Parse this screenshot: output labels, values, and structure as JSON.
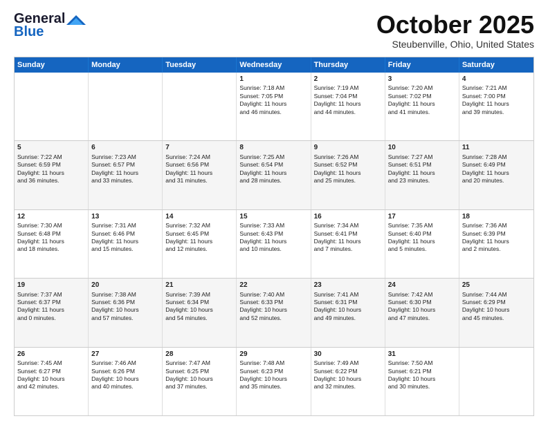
{
  "header": {
    "logo_general": "General",
    "logo_blue": "Blue",
    "month_title": "October 2025",
    "location": "Steubenville, Ohio, United States"
  },
  "days_of_week": [
    "Sunday",
    "Monday",
    "Tuesday",
    "Wednesday",
    "Thursday",
    "Friday",
    "Saturday"
  ],
  "rows": [
    {
      "alt": false,
      "cells": [
        {
          "day": "",
          "text": ""
        },
        {
          "day": "",
          "text": ""
        },
        {
          "day": "",
          "text": ""
        },
        {
          "day": "1",
          "text": "Sunrise: 7:18 AM\nSunset: 7:05 PM\nDaylight: 11 hours\nand 46 minutes."
        },
        {
          "day": "2",
          "text": "Sunrise: 7:19 AM\nSunset: 7:04 PM\nDaylight: 11 hours\nand 44 minutes."
        },
        {
          "day": "3",
          "text": "Sunrise: 7:20 AM\nSunset: 7:02 PM\nDaylight: 11 hours\nand 41 minutes."
        },
        {
          "day": "4",
          "text": "Sunrise: 7:21 AM\nSunset: 7:00 PM\nDaylight: 11 hours\nand 39 minutes."
        }
      ]
    },
    {
      "alt": true,
      "cells": [
        {
          "day": "5",
          "text": "Sunrise: 7:22 AM\nSunset: 6:59 PM\nDaylight: 11 hours\nand 36 minutes."
        },
        {
          "day": "6",
          "text": "Sunrise: 7:23 AM\nSunset: 6:57 PM\nDaylight: 11 hours\nand 33 minutes."
        },
        {
          "day": "7",
          "text": "Sunrise: 7:24 AM\nSunset: 6:56 PM\nDaylight: 11 hours\nand 31 minutes."
        },
        {
          "day": "8",
          "text": "Sunrise: 7:25 AM\nSunset: 6:54 PM\nDaylight: 11 hours\nand 28 minutes."
        },
        {
          "day": "9",
          "text": "Sunrise: 7:26 AM\nSunset: 6:52 PM\nDaylight: 11 hours\nand 25 minutes."
        },
        {
          "day": "10",
          "text": "Sunrise: 7:27 AM\nSunset: 6:51 PM\nDaylight: 11 hours\nand 23 minutes."
        },
        {
          "day": "11",
          "text": "Sunrise: 7:28 AM\nSunset: 6:49 PM\nDaylight: 11 hours\nand 20 minutes."
        }
      ]
    },
    {
      "alt": false,
      "cells": [
        {
          "day": "12",
          "text": "Sunrise: 7:30 AM\nSunset: 6:48 PM\nDaylight: 11 hours\nand 18 minutes."
        },
        {
          "day": "13",
          "text": "Sunrise: 7:31 AM\nSunset: 6:46 PM\nDaylight: 11 hours\nand 15 minutes."
        },
        {
          "day": "14",
          "text": "Sunrise: 7:32 AM\nSunset: 6:45 PM\nDaylight: 11 hours\nand 12 minutes."
        },
        {
          "day": "15",
          "text": "Sunrise: 7:33 AM\nSunset: 6:43 PM\nDaylight: 11 hours\nand 10 minutes."
        },
        {
          "day": "16",
          "text": "Sunrise: 7:34 AM\nSunset: 6:41 PM\nDaylight: 11 hours\nand 7 minutes."
        },
        {
          "day": "17",
          "text": "Sunrise: 7:35 AM\nSunset: 6:40 PM\nDaylight: 11 hours\nand 5 minutes."
        },
        {
          "day": "18",
          "text": "Sunrise: 7:36 AM\nSunset: 6:39 PM\nDaylight: 11 hours\nand 2 minutes."
        }
      ]
    },
    {
      "alt": true,
      "cells": [
        {
          "day": "19",
          "text": "Sunrise: 7:37 AM\nSunset: 6:37 PM\nDaylight: 11 hours\nand 0 minutes."
        },
        {
          "day": "20",
          "text": "Sunrise: 7:38 AM\nSunset: 6:36 PM\nDaylight: 10 hours\nand 57 minutes."
        },
        {
          "day": "21",
          "text": "Sunrise: 7:39 AM\nSunset: 6:34 PM\nDaylight: 10 hours\nand 54 minutes."
        },
        {
          "day": "22",
          "text": "Sunrise: 7:40 AM\nSunset: 6:33 PM\nDaylight: 10 hours\nand 52 minutes."
        },
        {
          "day": "23",
          "text": "Sunrise: 7:41 AM\nSunset: 6:31 PM\nDaylight: 10 hours\nand 49 minutes."
        },
        {
          "day": "24",
          "text": "Sunrise: 7:42 AM\nSunset: 6:30 PM\nDaylight: 10 hours\nand 47 minutes."
        },
        {
          "day": "25",
          "text": "Sunrise: 7:44 AM\nSunset: 6:29 PM\nDaylight: 10 hours\nand 45 minutes."
        }
      ]
    },
    {
      "alt": false,
      "cells": [
        {
          "day": "26",
          "text": "Sunrise: 7:45 AM\nSunset: 6:27 PM\nDaylight: 10 hours\nand 42 minutes."
        },
        {
          "day": "27",
          "text": "Sunrise: 7:46 AM\nSunset: 6:26 PM\nDaylight: 10 hours\nand 40 minutes."
        },
        {
          "day": "28",
          "text": "Sunrise: 7:47 AM\nSunset: 6:25 PM\nDaylight: 10 hours\nand 37 minutes."
        },
        {
          "day": "29",
          "text": "Sunrise: 7:48 AM\nSunset: 6:23 PM\nDaylight: 10 hours\nand 35 minutes."
        },
        {
          "day": "30",
          "text": "Sunrise: 7:49 AM\nSunset: 6:22 PM\nDaylight: 10 hours\nand 32 minutes."
        },
        {
          "day": "31",
          "text": "Sunrise: 7:50 AM\nSunset: 6:21 PM\nDaylight: 10 hours\nand 30 minutes."
        },
        {
          "day": "",
          "text": ""
        }
      ]
    }
  ]
}
